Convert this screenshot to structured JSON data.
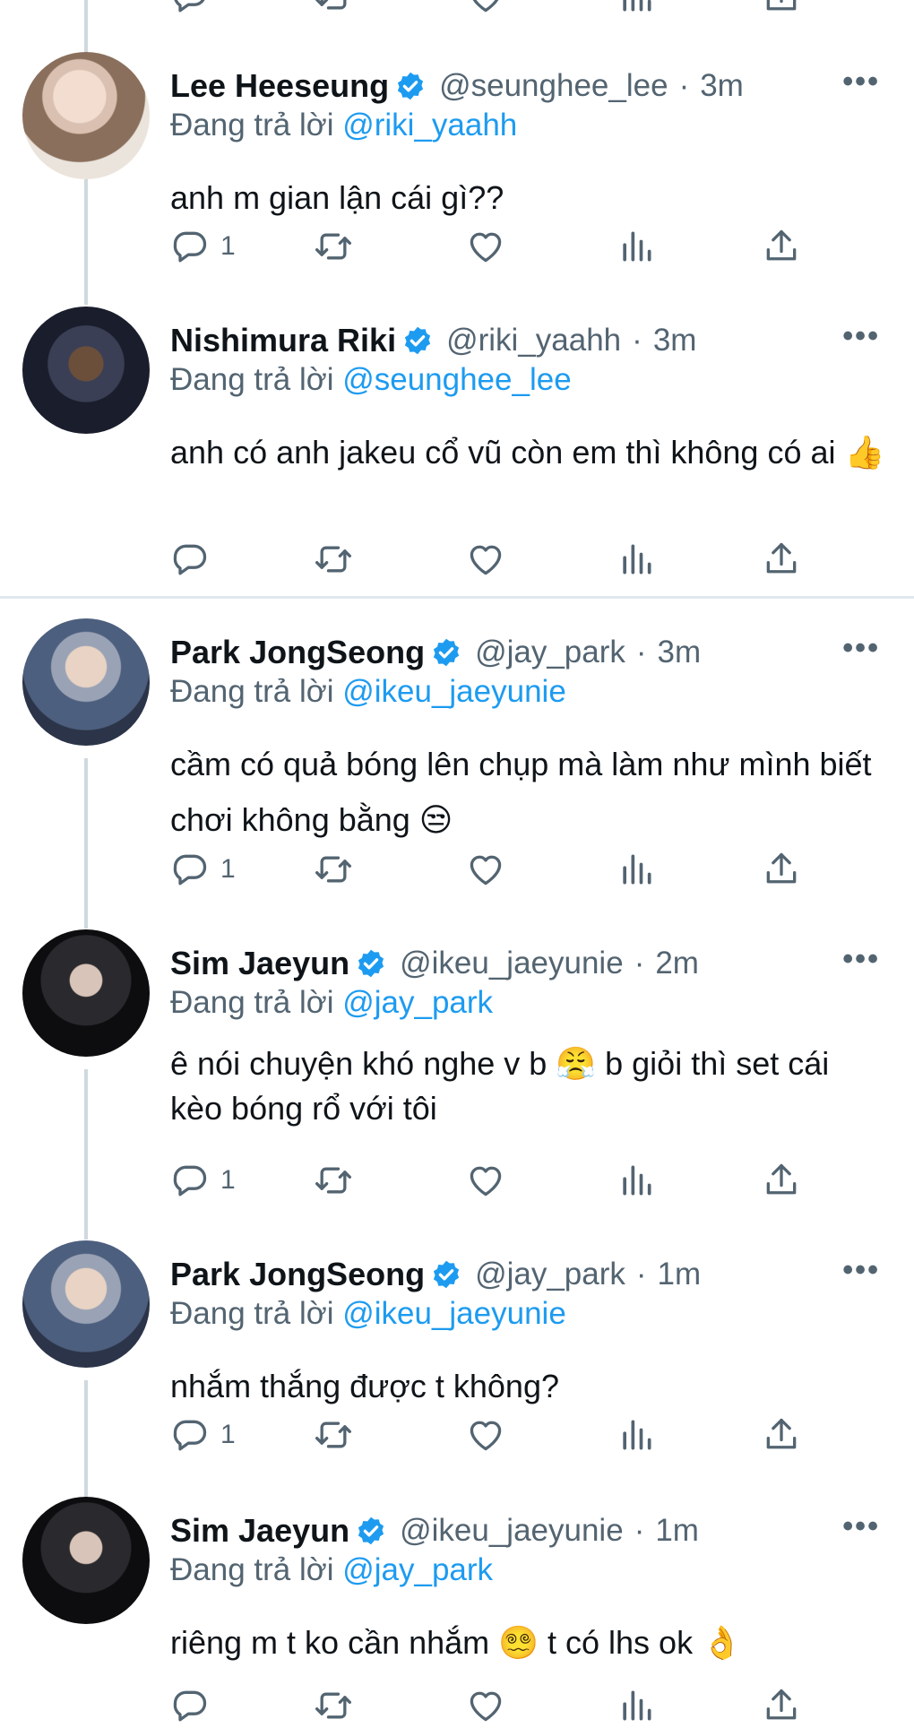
{
  "colors": {
    "accent": "#1d9bf0",
    "secondary_text": "#536471",
    "primary_text": "#0f1419"
  },
  "icons": {
    "reply": "reply-icon",
    "retweet": "retweet-icon",
    "like": "heart-icon",
    "views": "bar-chart-icon",
    "share": "share-icon",
    "verified": "verified-badge-icon",
    "more": "more-icon"
  },
  "replying_label": "Đang trả lời",
  "tweets": [
    {
      "name": "Lee Heeseung",
      "handle": "@seunghee_lee",
      "dot": "·",
      "time": "3m",
      "more": "•••",
      "replying_to": "@riki_yaahh",
      "text": "anh m gian lận cái gì??",
      "reply_count": "1"
    },
    {
      "name": "Nishimura Riki",
      "handle": "@riki_yaahh",
      "dot": "·",
      "time": "3m",
      "more": "•••",
      "replying_to": "@seunghee_lee",
      "text": "anh có anh jakeu cổ vũ còn em thì không có ai 👍",
      "reply_count": ""
    },
    {
      "name": "Park JongSeong",
      "handle": "@jay_park",
      "dot": "·",
      "time": "3m",
      "more": "•••",
      "replying_to": "@ikeu_jaeyunie",
      "text": "cầm có quả bóng lên chụp mà làm như mình biết chơi không bằng 😒",
      "reply_count": "1"
    },
    {
      "name": "Sim Jaeyun",
      "handle": "@ikeu_jaeyunie",
      "dot": "·",
      "time": "2m",
      "more": "•••",
      "replying_to": "@jay_park",
      "text": "ê nói chuyện khó nghe v b 😤  b giỏi thì set cái kèo bóng rổ với tôi",
      "reply_count": "1"
    },
    {
      "name": "Park JongSeong",
      "handle": "@jay_park",
      "dot": "·",
      "time": "1m",
      "more": "•••",
      "replying_to": "@ikeu_jaeyunie",
      "text": "nhắm thắng được t không?",
      "reply_count": "1"
    },
    {
      "name": "Sim Jaeyun",
      "handle": "@ikeu_jaeyunie",
      "dot": "·",
      "time": "1m",
      "more": "•••",
      "replying_to": "@jay_park",
      "text": "riêng m t ko cần nhắm 😵‍💫  t có lhs ok 👌",
      "reply_count": ""
    }
  ]
}
